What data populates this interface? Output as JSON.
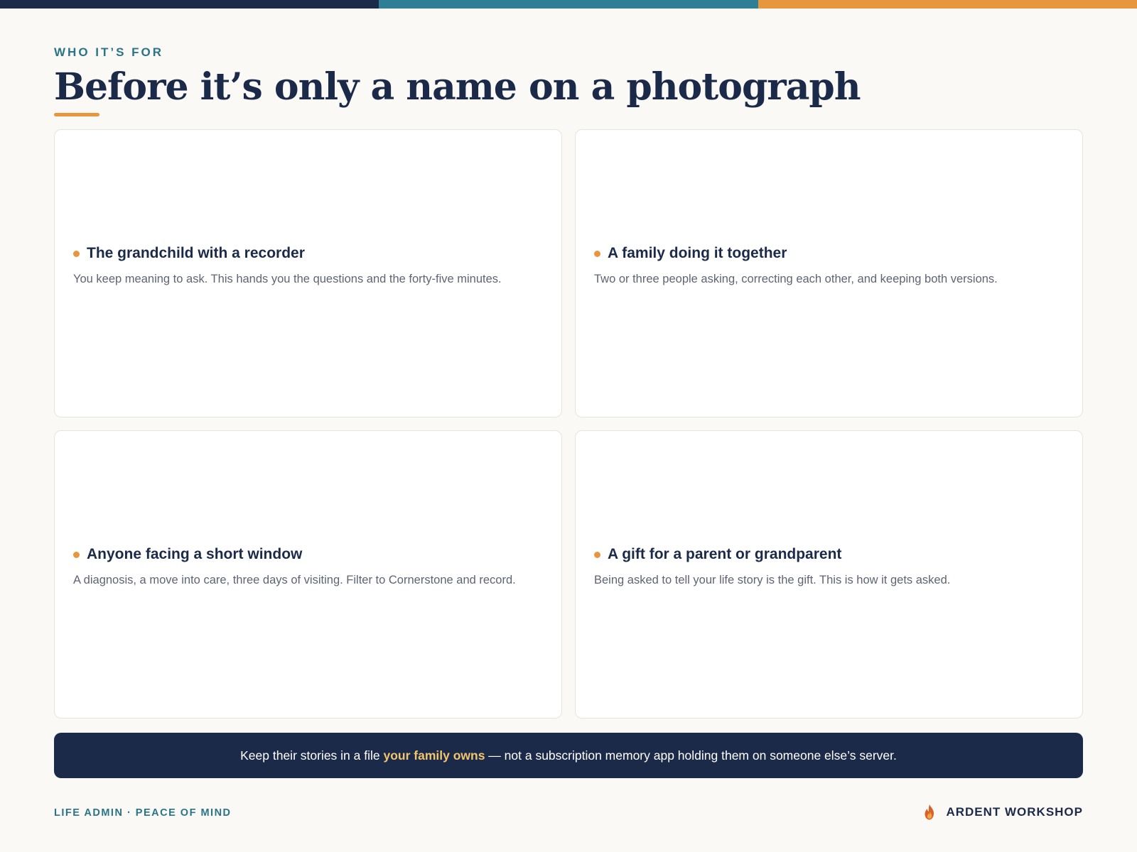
{
  "colors": {
    "navy": "#1C2A4A",
    "teal": "#2E7F95",
    "orange": "#E8963D",
    "highlight": "#F1C56D",
    "background": "#FAF9F5"
  },
  "header": {
    "eyebrow": "WHO IT’S FOR",
    "title": "Before it’s only a name on a photograph"
  },
  "cards": [
    {
      "title": "The grandchild with a recorder",
      "description": "You keep meaning to ask. This hands you the questions and the forty-five minutes."
    },
    {
      "title": "A family doing it together",
      "description": "Two or three people asking, correcting each other, and keeping both versions."
    },
    {
      "title": "Anyone facing a short window",
      "description": "A diagnosis, a move into care, three days of visiting. Filter to Cornerstone and record."
    },
    {
      "title": "A gift for a parent or grandparent",
      "description": "Being asked to tell your life story is the gift. This is how it gets asked."
    }
  ],
  "banner": {
    "before": "Keep their stories in a file ",
    "highlight": "your family owns",
    "after": " — not a subscription memory app holding them on someone else’s server."
  },
  "footer": {
    "left": "LIFE ADMIN · PEACE OF MIND",
    "brand_icon": "flame-icon",
    "brand_name": "ARDENT WORKSHOP"
  }
}
